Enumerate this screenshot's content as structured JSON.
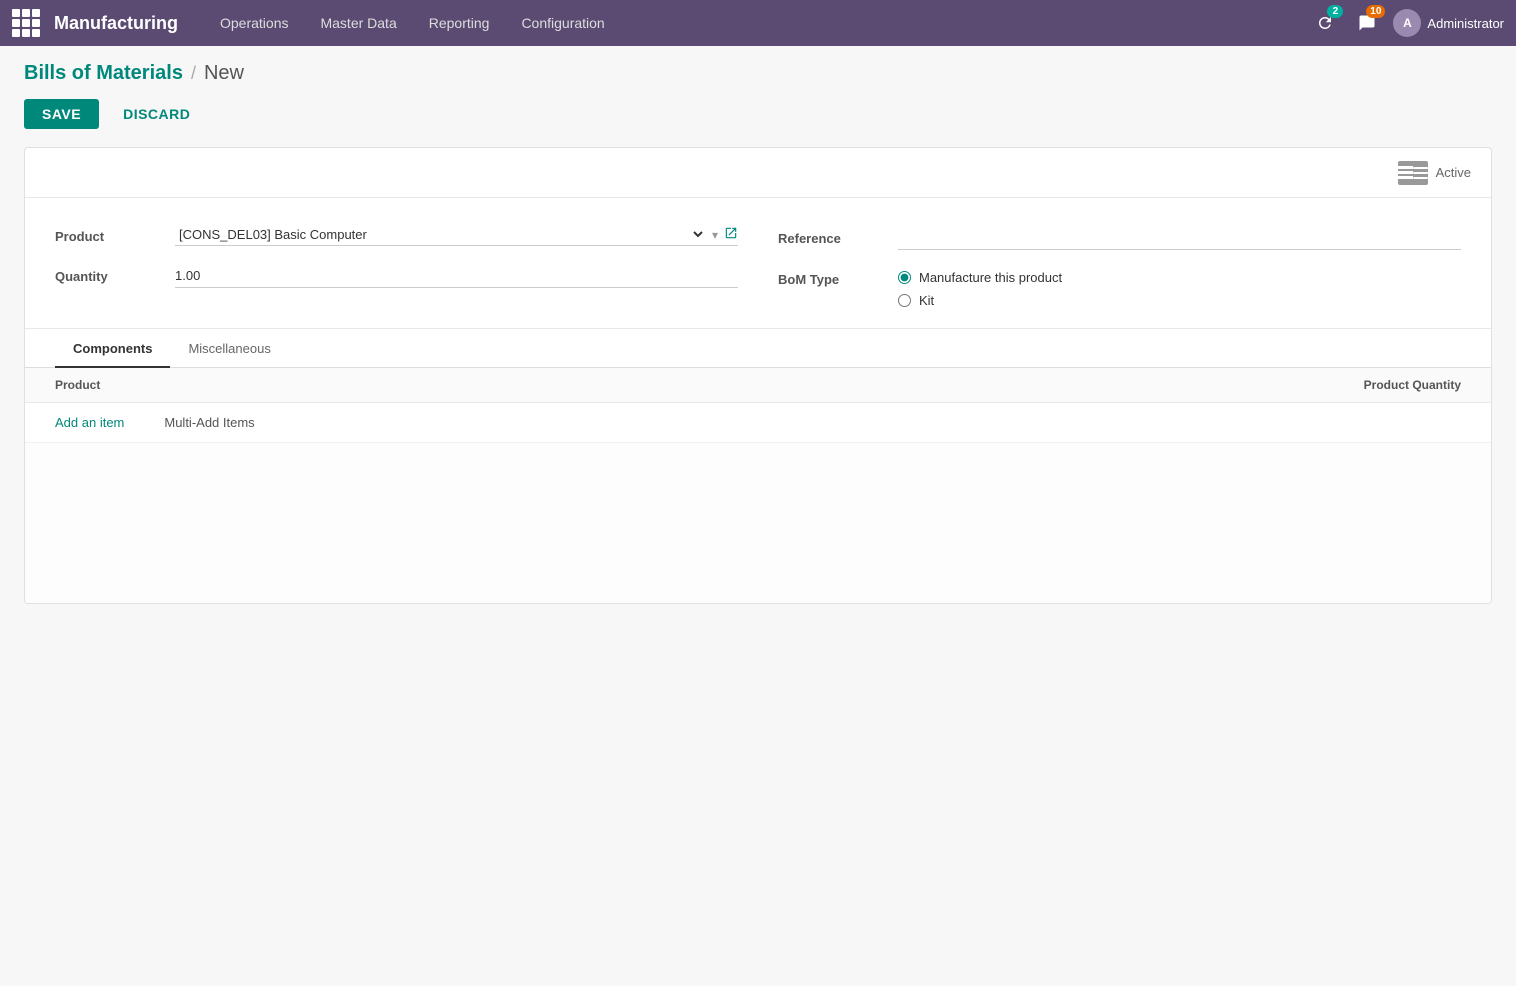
{
  "topbar": {
    "app_name": "Manufacturing",
    "nav_items": [
      {
        "id": "operations",
        "label": "Operations"
      },
      {
        "id": "master_data",
        "label": "Master Data"
      },
      {
        "id": "reporting",
        "label": "Reporting"
      },
      {
        "id": "configuration",
        "label": "Configuration"
      }
    ],
    "badges": [
      {
        "id": "refresh",
        "icon": "refresh",
        "count": "2",
        "color": "teal"
      },
      {
        "id": "messages",
        "icon": "chat",
        "count": "10",
        "color": "orange"
      }
    ],
    "admin_label": "Administrator"
  },
  "breadcrumb": {
    "parent_label": "Bills of Materials",
    "separator": "/",
    "current_label": "New"
  },
  "actions": {
    "save_label": "SAVE",
    "discard_label": "DISCARD"
  },
  "form": {
    "product_label": "Product",
    "product_value": "[CONS_DEL03] Basic Computer",
    "quantity_label": "Quantity",
    "quantity_value": "1.00",
    "reference_label": "Reference",
    "reference_value": "",
    "bom_type_label": "BoM Type",
    "bom_type_options": [
      {
        "id": "manufacture",
        "label": "Manufacture this product",
        "checked": true
      },
      {
        "id": "kit",
        "label": "Kit",
        "checked": false
      }
    ]
  },
  "status": {
    "label": "Active"
  },
  "tabs": [
    {
      "id": "components",
      "label": "Components",
      "active": true
    },
    {
      "id": "miscellaneous",
      "label": "Miscellaneous",
      "active": false
    }
  ],
  "table": {
    "col_product": "Product",
    "col_quantity": "Product Quantity",
    "add_item_label": "Add an item",
    "multi_add_label": "Multi-Add Items"
  }
}
